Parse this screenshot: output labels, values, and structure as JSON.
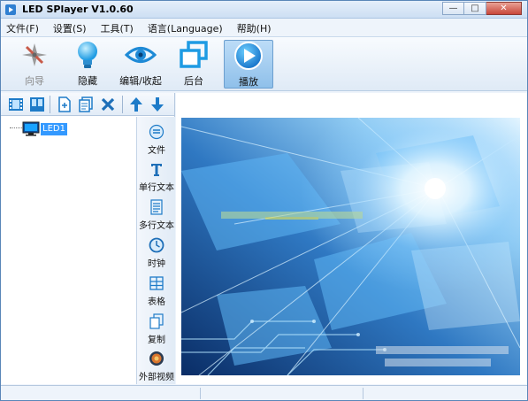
{
  "window": {
    "title": "LED SPlayer V1.0.60"
  },
  "menu": [
    "文件(F)",
    "设置(S)",
    "工具(T)",
    "语言(Language)",
    "帮助(H)"
  ],
  "toolbar": {
    "guide": "向导",
    "hide": "隐藏",
    "edit_collapse": "编辑/收起",
    "background": "后台",
    "play": "播放"
  },
  "tree": {
    "node": "LED1"
  },
  "side_tools": {
    "file": "文件",
    "single_text": "单行文本",
    "multi_text": "多行文本",
    "clock": "时钟",
    "table": "表格",
    "copy": "复制",
    "external_video": "外部视频"
  },
  "colors": {
    "accent": "#3399ff",
    "toolbar_active": "#8fc0ea",
    "close_button": "#c8463a",
    "preview_base": "#0a2d66"
  },
  "icons": {
    "guide": "compass-icon",
    "hide": "lightbulb-icon",
    "edit_collapse": "eye-icon",
    "background": "windows-icon",
    "play": "play-icon"
  }
}
